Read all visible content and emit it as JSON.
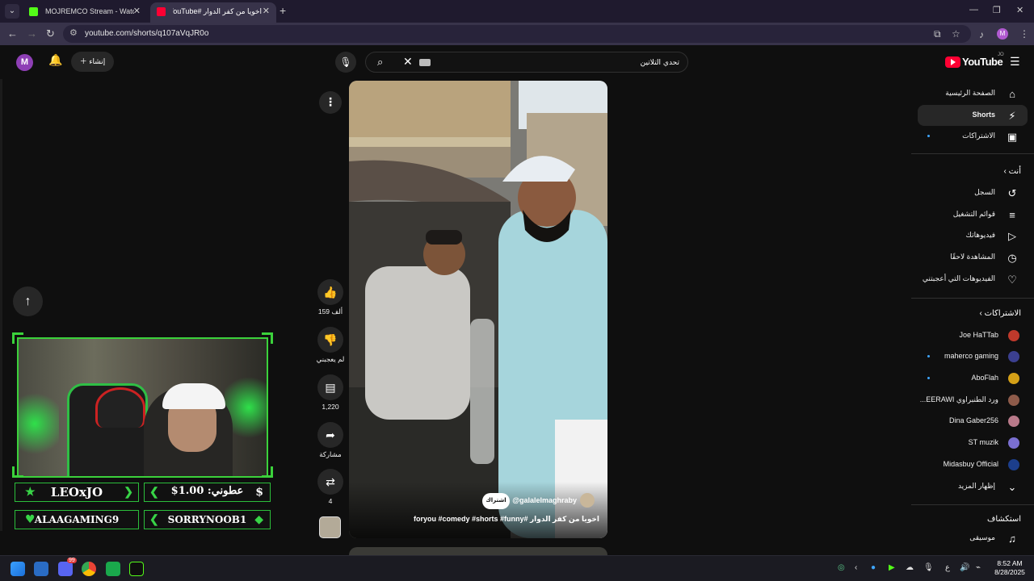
{
  "browser": {
    "tabs": [
      {
        "title": "MOJREMCO Stream - Watch Li",
        "favicon_color": "#53fc18",
        "active": false
      },
      {
        "title": "اخويا من كفر الدوار #YouTube",
        "favicon_color": "#ff0033",
        "active": true
      }
    ],
    "url": "youtube.com/shorts/q107aVqJR0o",
    "profile_letter": "M"
  },
  "header": {
    "avatar_letter": "M",
    "create_label": "إنشاء",
    "search_value": "تحدي التلاتين",
    "search_placeholder": "بحث",
    "logo_text": "YouTube",
    "logo_country": "JO"
  },
  "sidebar": {
    "main": [
      {
        "label": "الصفحة الرئيسية",
        "icon": "home-icon",
        "glyph": "⌂"
      },
      {
        "label": "Shorts",
        "icon": "shorts-icon",
        "glyph": "⚡",
        "active": true
      },
      {
        "label": "الاشتراكات",
        "icon": "subscriptions-icon",
        "glyph": "▣",
        "dot": true
      }
    ],
    "you_heading": "أنت",
    "you": [
      {
        "label": "السجل",
        "icon": "history-icon",
        "glyph": "↺"
      },
      {
        "label": "قوائم التشغيل",
        "icon": "playlists-icon",
        "glyph": "≡"
      },
      {
        "label": "فيديوهاتك",
        "icon": "your-videos-icon",
        "glyph": "▷"
      },
      {
        "label": "المشاهدة لاحقًا",
        "icon": "watch-later-icon",
        "glyph": "◷"
      },
      {
        "label": "الفيديوهات التي أعجبتني",
        "icon": "liked-icon",
        "glyph": "👍"
      }
    ],
    "subs_heading": "الاشتراكات",
    "subs": [
      {
        "label": "Joe HaTTab",
        "color": "#c0392b",
        "dot": false
      },
      {
        "label": "maherco gaming",
        "color": "#3b3f8f",
        "dot": true
      },
      {
        "label": "AboFlah",
        "color": "#d4a017",
        "dot": true
      },
      {
        "label": "ورد الطنبراوي EERAWI...",
        "color": "#8e5b4a",
        "dot": false
      },
      {
        "label": "Dina Gaber256",
        "color": "#b97a8a",
        "dot": false
      },
      {
        "label": "ST muzik",
        "color": "#7a6fd1",
        "dot": false
      },
      {
        "label": "Midasbuy Official",
        "color": "#1c3e8c",
        "dot": false
      }
    ],
    "show_more": "إظهار المزيد",
    "explore_heading": "استكشاف",
    "explore": [
      {
        "label": "موسيقى",
        "icon": "music-icon",
        "glyph": "♫"
      }
    ]
  },
  "short": {
    "channel": "@galalelmaghraby",
    "subscribe_label": "اشتراك",
    "title": "اخويا من كفر الدوار #foryou #comedy #shorts #funny",
    "likes": "159 ألف",
    "dislike_label": "لم يعجبني",
    "comments": "1,220",
    "share_label": "مشاركة",
    "remix": "4"
  },
  "overlay": {
    "badges": [
      {
        "text": "LEOxJO"
      },
      {
        "text": "عطوني: 1.00$"
      },
      {
        "text": "ALAAGAMING9"
      },
      {
        "text": "SORRYNOOB1"
      }
    ]
  },
  "taskbar": {
    "time": "8:52 AM",
    "date": "8/28/2025",
    "lang": "ع",
    "discord_badge": "99"
  }
}
